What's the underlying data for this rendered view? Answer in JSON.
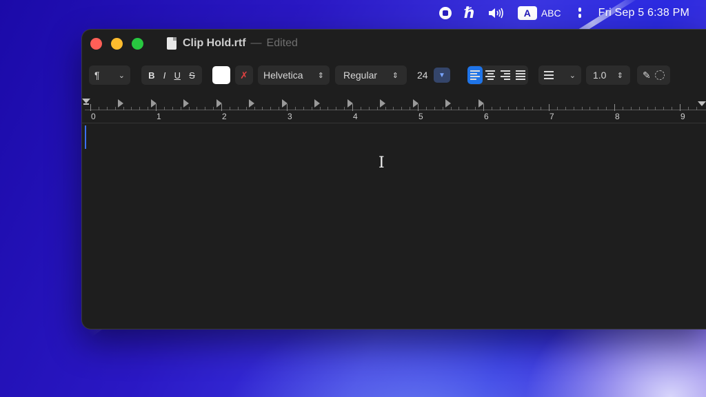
{
  "menubar": {
    "input_badge": "A",
    "input_label": "ABC",
    "clock": "Fri Sep 5  6:38 PM",
    "icons": [
      "record-icon",
      "h-app-icon",
      "volume-icon",
      "control-center-icon"
    ]
  },
  "window": {
    "title": "Clip Hold.rtf",
    "separator": "—",
    "status": "Edited"
  },
  "toolbar": {
    "paragraph_glyph": "¶",
    "bold": "B",
    "italic": "I",
    "underline": "U",
    "strikethrough": "S",
    "text_color": "#ffffff",
    "font_family": "Helvetica",
    "font_style": "Regular",
    "font_size": "24",
    "alignment": "left",
    "line_spacing": "1.0"
  },
  "ruler": {
    "numbers": [
      "0",
      "1",
      "2",
      "3",
      "4",
      "5",
      "6",
      "7",
      "8",
      "9"
    ]
  },
  "colors": {
    "accent": "#1f74e8",
    "window_bg": "#1e1e1e",
    "close": "#ff5f57",
    "minimize": "#febc2e",
    "zoom": "#28c840"
  }
}
